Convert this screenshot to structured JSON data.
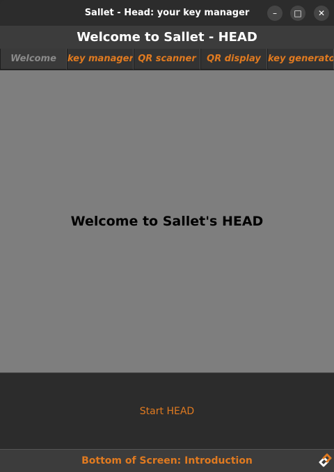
{
  "window": {
    "title": "Sallet - Head: your key manager",
    "min_glyph": "–",
    "max_glyph": "□",
    "close_glyph": "✕"
  },
  "header": {
    "title": "Welcome to Sallet - HEAD"
  },
  "tabs": [
    {
      "label": "Welcome",
      "active": true
    },
    {
      "label": "key manager",
      "active": false
    },
    {
      "label": "QR scanner",
      "active": false
    },
    {
      "label": "QR display",
      "active": false
    },
    {
      "label": "key generator",
      "active": false
    }
  ],
  "main": {
    "welcome_text": "Welcome to Sallet's HEAD"
  },
  "actions": {
    "start_label": "Start HEAD"
  },
  "footer": {
    "text": "Bottom of Screen: Introduction",
    "icon": "link-icon"
  },
  "colors": {
    "accent": "#e07a20",
    "content_bg": "#7e7e7e",
    "dark_bg": "#2c2c2c"
  }
}
